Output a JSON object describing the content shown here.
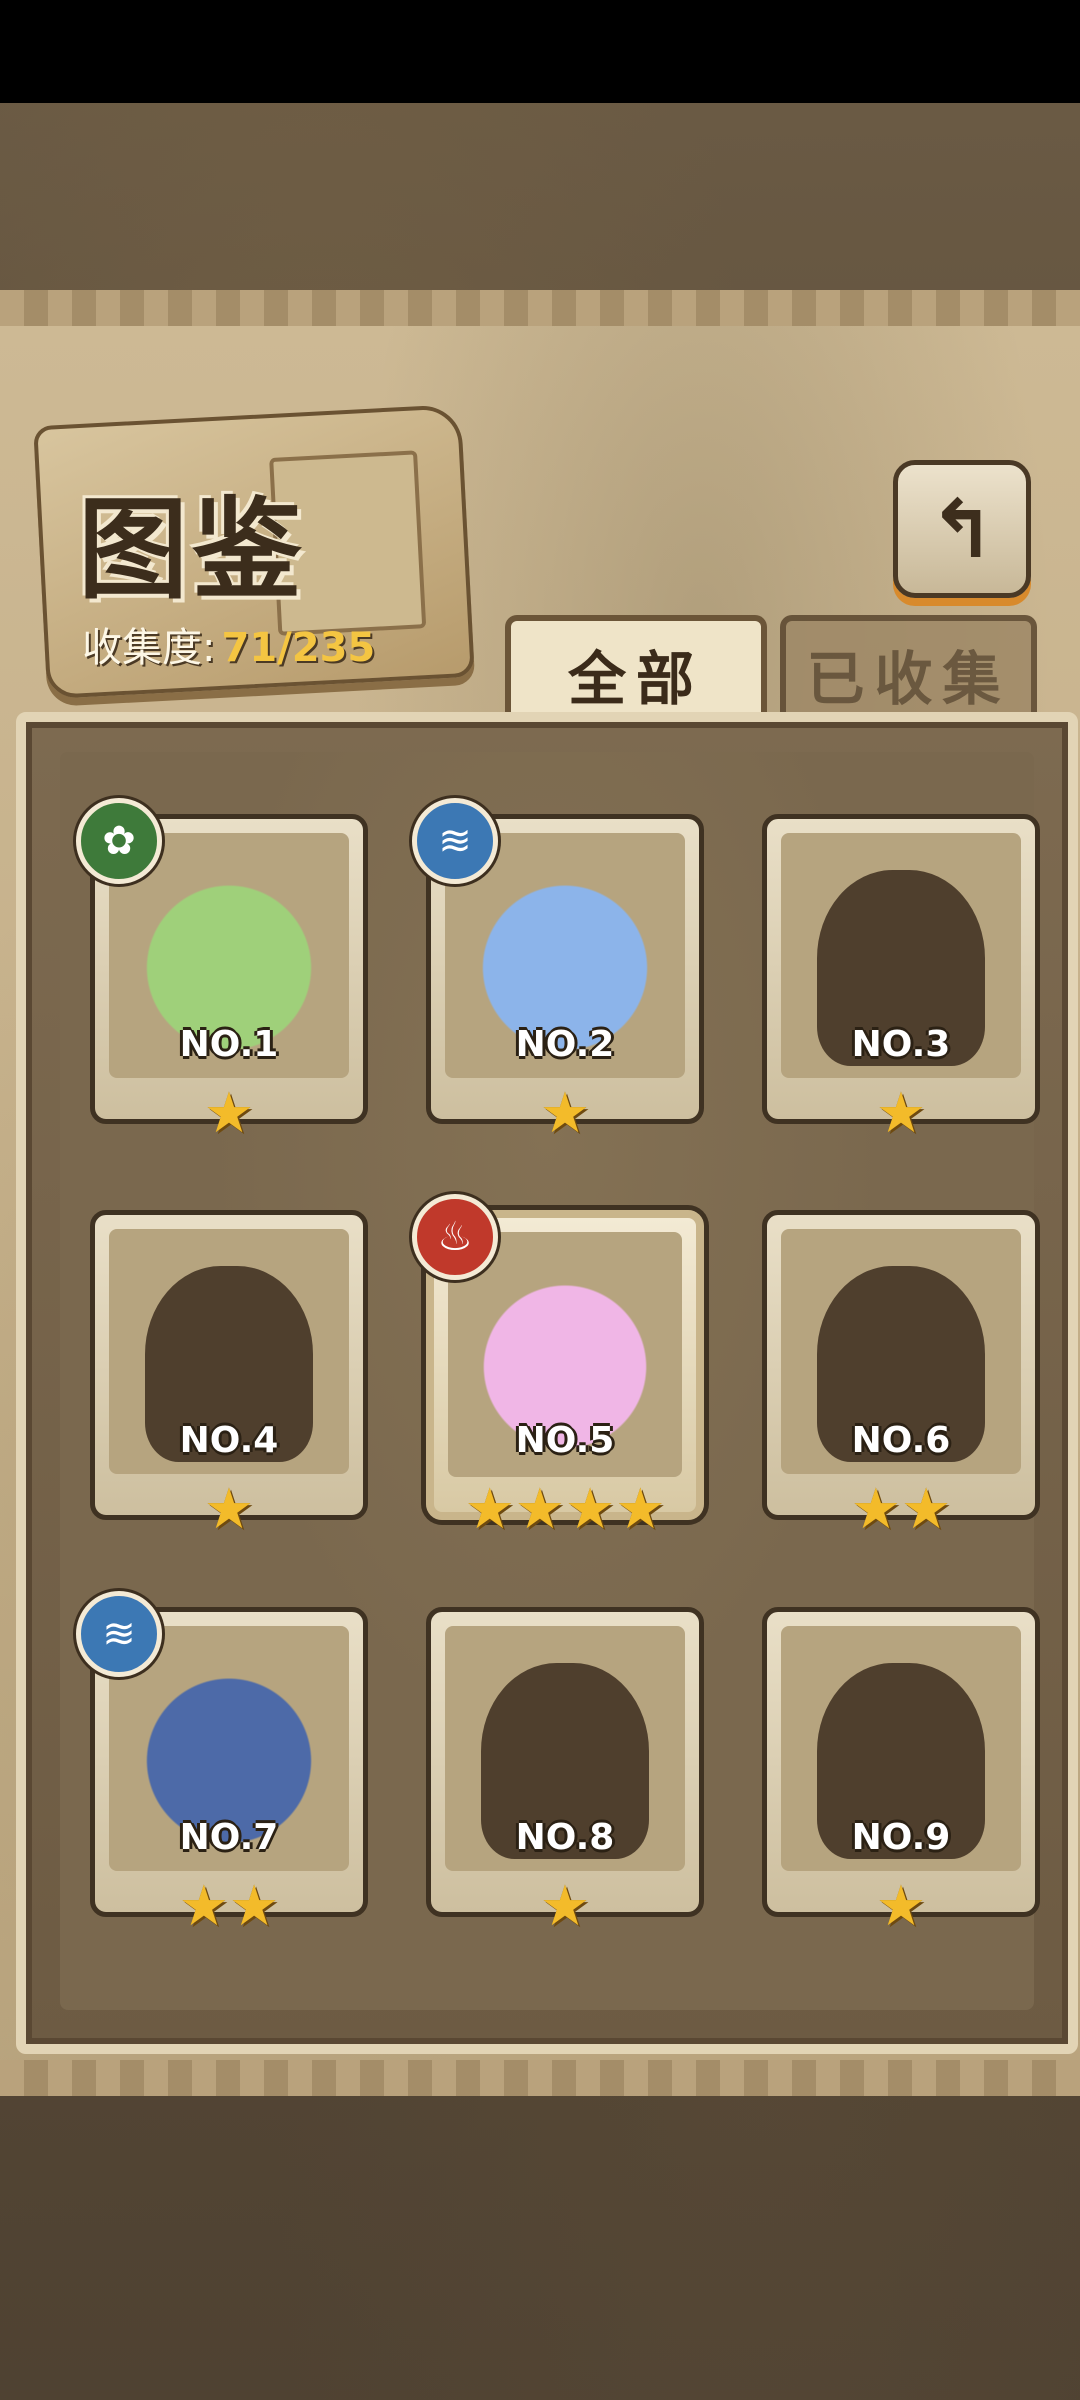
{
  "header": {
    "title": "图鉴",
    "collect_label": "收集度:",
    "collect_value": "71/235",
    "back_icon": "back-arrow-icon"
  },
  "tabs": [
    {
      "label": "全部",
      "active": true
    },
    {
      "label": "已收集",
      "active": false
    }
  ],
  "cards": [
    {
      "num": "NO.1",
      "stars": "★",
      "element": "leaf",
      "unlocked": true,
      "color": "#9fd07a"
    },
    {
      "num": "NO.2",
      "stars": "★",
      "element": "water",
      "unlocked": true,
      "color": "#8cb4ea"
    },
    {
      "num": "NO.3",
      "stars": "★",
      "element": "",
      "unlocked": false
    },
    {
      "num": "NO.4",
      "stars": "★",
      "element": "",
      "unlocked": false
    },
    {
      "num": "NO.5",
      "stars": "★★★★",
      "element": "fire",
      "unlocked": true,
      "color": "#f0b6e6"
    },
    {
      "num": "NO.6",
      "stars": "★★",
      "element": "",
      "unlocked": false
    },
    {
      "num": "NO.7",
      "stars": "★★",
      "element": "water",
      "unlocked": true,
      "color": "#4d6aa8"
    },
    {
      "num": "NO.8",
      "stars": "★",
      "element": "",
      "unlocked": false
    },
    {
      "num": "NO.9",
      "stars": "★",
      "element": "",
      "unlocked": false
    }
  ],
  "colors": {
    "leaf": "#3e7a3a",
    "water": "#3c78b4",
    "fire": "#c0392b",
    "star": "#f3bb2a"
  }
}
